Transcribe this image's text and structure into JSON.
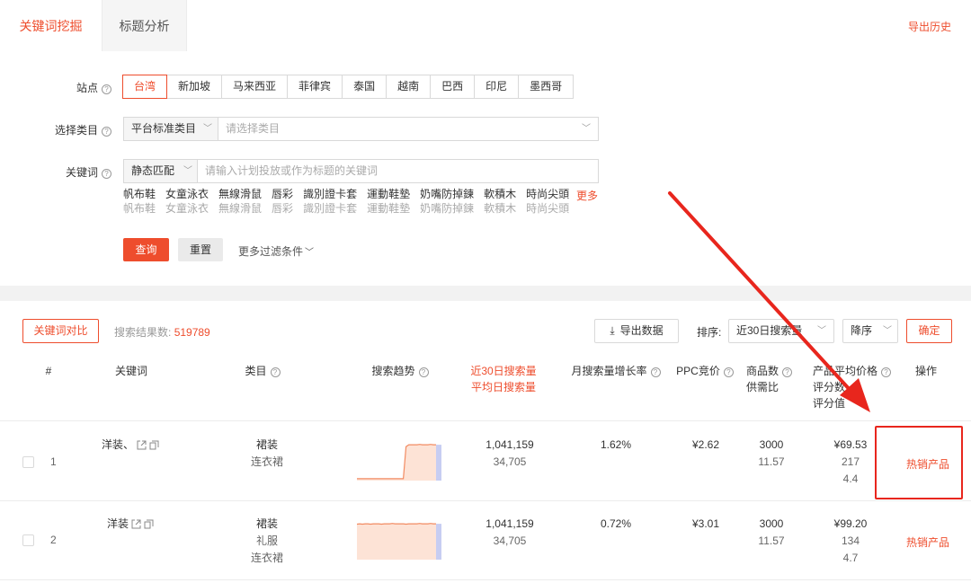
{
  "tabs": [
    {
      "label": "关键词挖掘"
    },
    {
      "label": "标题分析"
    }
  ],
  "export_history": "导出历史",
  "filters": {
    "site_label": "站点",
    "sites": [
      "台湾",
      "新加坡",
      "马来西亚",
      "菲律宾",
      "泰国",
      "越南",
      "巴西",
      "印尼",
      "墨西哥"
    ],
    "category_label": "选择类目",
    "category_mode": "平台标准类目",
    "category_placeholder": "请选择类目",
    "keyword_label": "关键词",
    "keyword_mode": "静态匹配",
    "keyword_placeholder": "请输入计划投放或作为标题的关键词",
    "suggestions": [
      {
        "a": "帆布鞋",
        "b": "帆布鞋"
      },
      {
        "a": "女童泳衣",
        "b": "女童泳衣"
      },
      {
        "a": "無線滑鼠",
        "b": "無線滑鼠"
      },
      {
        "a": "唇彩",
        "b": "唇彩"
      },
      {
        "a": "識別證卡套",
        "b": "識別證卡套"
      },
      {
        "a": "運動鞋墊",
        "b": "運動鞋墊"
      },
      {
        "a": "奶嘴防掉鍊",
        "b": "奶嘴防掉鍊"
      },
      {
        "a": "軟積木",
        "b": "軟積木"
      },
      {
        "a": "時尚尖頭",
        "b": "時尚尖頭"
      }
    ],
    "more": "更多",
    "query": "查询",
    "reset": "重置",
    "more_filters": "更多过滤条件"
  },
  "results": {
    "compare": "关键词对比",
    "count_label": "搜索结果数:",
    "count": "519789",
    "export": "导出数据",
    "sort_label": "排序:",
    "sort_value": "近30日搜索量",
    "order_value": "降序",
    "confirm": "确定"
  },
  "table": {
    "headers": {
      "index": "#",
      "keyword": "关键词",
      "category": "类目",
      "trend": "搜索趋势",
      "search30": "近30日搜索量",
      "search_daily": "平均日搜索量",
      "growth": "月搜索量增长率",
      "ppc": "PPC竞价",
      "products": "商品数",
      "supply": "供需比",
      "price": "产品平均价格",
      "reviews": "评分数",
      "rating": "评分值",
      "action": "操作"
    },
    "rows": [
      {
        "index": "1",
        "keyword": "洋装、",
        "categories": [
          "裙装",
          "连衣裙"
        ],
        "trend": [
          0.05,
          0.05,
          0.05,
          0.05,
          0.05,
          0.05,
          0.05,
          0.05,
          0.05,
          0.05,
          0.05,
          0.05,
          0.05,
          0.05,
          0.05,
          0.05,
          0.05,
          0.05,
          0.9,
          0.95,
          0.95,
          0.95,
          0.95,
          0.96,
          0.95,
          0.95,
          0.95,
          0.96,
          0.95,
          0.95
        ],
        "search30": "1,041,159",
        "search_daily": "34,705",
        "growth": "1.62%",
        "ppc": "¥2.62",
        "products": "3000",
        "supply": "11.57",
        "price": "¥69.53",
        "reviews": "217",
        "rating": "4.4",
        "action": "热销产品"
      },
      {
        "index": "2",
        "keyword": "洋装",
        "categories": [
          "裙装",
          "礼服",
          "连衣裙"
        ],
        "trend": [
          0.94,
          0.95,
          0.94,
          0.95,
          0.95,
          0.94,
          0.95,
          0.95,
          0.95,
          0.94,
          0.95,
          0.95,
          0.95,
          0.96,
          0.95,
          0.95,
          0.95,
          0.95,
          0.94,
          0.95,
          0.95,
          0.95,
          0.95,
          0.96,
          0.95,
          0.95,
          0.95,
          0.96,
          0.95,
          0.95
        ],
        "search30": "1,041,159",
        "search_daily": "34,705",
        "growth": "0.72%",
        "ppc": "¥3.01",
        "products": "3000",
        "supply": "11.57",
        "price": "¥99.20",
        "reviews": "134",
        "rating": "4.7",
        "action": "热销产品"
      }
    ]
  },
  "colors": {
    "accent": "#ee4d2d",
    "annotation": "#e8261d",
    "trend_fill": "#fde3d6",
    "trend_line": "#f28b62",
    "trend_bar": "#c7cdf2"
  }
}
